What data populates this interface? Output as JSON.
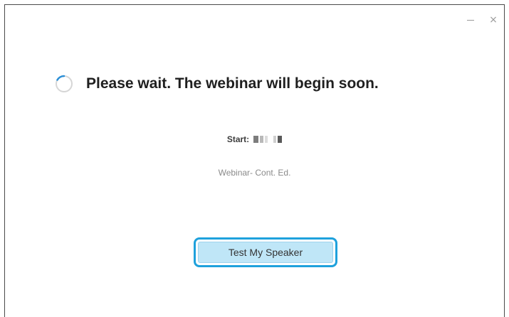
{
  "window": {
    "controls": {
      "minimize_icon": "minimize-icon",
      "close_icon": "close-icon",
      "close_glyph": "×"
    }
  },
  "main": {
    "headline": "Please wait. The webinar will begin soon.",
    "start_label": "Start:",
    "webinar_topic": "Webinar- Cont. Ed.",
    "test_speaker_label": "Test My Speaker"
  },
  "colors": {
    "accent": "#1ea1dc",
    "button_fill": "#bfe6f7",
    "spinner_arc": "#2c8fd6"
  }
}
